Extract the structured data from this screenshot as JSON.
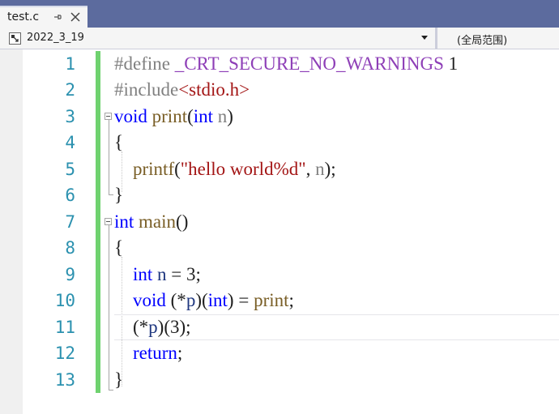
{
  "tab": {
    "title": "test.c",
    "pin_icon": "pin-icon",
    "close_icon": "close-icon"
  },
  "navbar": {
    "project": "2022_3_19",
    "scope": "(全局范围)"
  },
  "colors": {
    "tabstrip": "#5c6b9e",
    "change_bar": "#6fd26f",
    "line_number": "#2b91af",
    "keyword": "#0000ff",
    "string": "#a31515"
  },
  "code": {
    "line_numbers": [
      "1",
      "2",
      "3",
      "4",
      "5",
      "6",
      "7",
      "8",
      "9",
      "10",
      "11",
      "12",
      "13"
    ],
    "l1": {
      "directive": "#define",
      "macro": "_CRT_SECURE_NO_WARNINGS",
      "value": "1"
    },
    "l2": {
      "directive": "#include",
      "header": "<stdio.h>"
    },
    "l3": {
      "kw": "void",
      "name": "print",
      "open": "(",
      "ptype": "int",
      "pname": "n",
      "close": ")"
    },
    "l4": {
      "brace": "{"
    },
    "l5": {
      "call": "printf",
      "open": "(",
      "str": "\"hello world%d\"",
      "comma": ", ",
      "arg": "n",
      "close": ");"
    },
    "l6": {
      "brace": "}"
    },
    "l7": {
      "kw": "int",
      "name": "main",
      "parens": "()"
    },
    "l8": {
      "brace": "{"
    },
    "l9": {
      "kw": "int",
      "var": "n",
      "rest": " = 3;"
    },
    "l10": {
      "kw": "void",
      "open": " (*",
      "var": "p",
      "mid": ")(",
      "ptype": "int",
      "assign": ") = ",
      "fn": "print",
      "end": ";"
    },
    "l11": {
      "open": "(*",
      "var": "p",
      "end": ")(3);"
    },
    "l12": {
      "kw": "return",
      "end": ";"
    },
    "l13": {
      "brace": "}"
    }
  }
}
